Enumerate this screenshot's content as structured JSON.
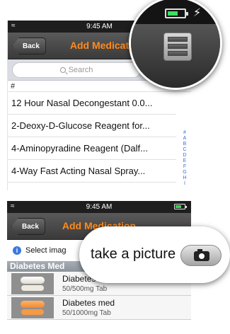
{
  "screen1": {
    "status": {
      "time": "9:45 AM"
    },
    "nav": {
      "back_label": "Back",
      "title": "Add Medicat"
    },
    "search": {
      "placeholder": "Search"
    },
    "section_header": "#",
    "rows": [
      "12 Hour Nasal Decongestant 0.0...",
      "2-Deoxy-D-Glucose Reagent for...",
      "4-Aminopyradine Reagent (Dalf...",
      "4-Way Fast Acting Nasal Spray..."
    ],
    "index_letters": [
      "#",
      "A",
      "B",
      "C",
      "D",
      "E",
      "F",
      "G",
      "H",
      "I"
    ]
  },
  "screen2": {
    "status": {
      "time": "9:45 AM"
    },
    "nav": {
      "back_label": "Back",
      "title": "Add Medication"
    },
    "info_text": "Select imag",
    "section_header": "Diabetes Med",
    "meds": [
      {
        "name": "Diabetes med",
        "dose": "50/500mg  Tab",
        "pill_color": "#f2efe6"
      },
      {
        "name": "Diabetes med",
        "dose": "50/1000mg  Tab",
        "pill_color": "#f59a45"
      }
    ]
  },
  "zoom_camera": {
    "text": "take a picture"
  },
  "colors": {
    "accent": "#ff8a1c",
    "index_blue": "#3a6dd8",
    "info_blue": "#3a78e0",
    "battery_green": "#39d353"
  }
}
